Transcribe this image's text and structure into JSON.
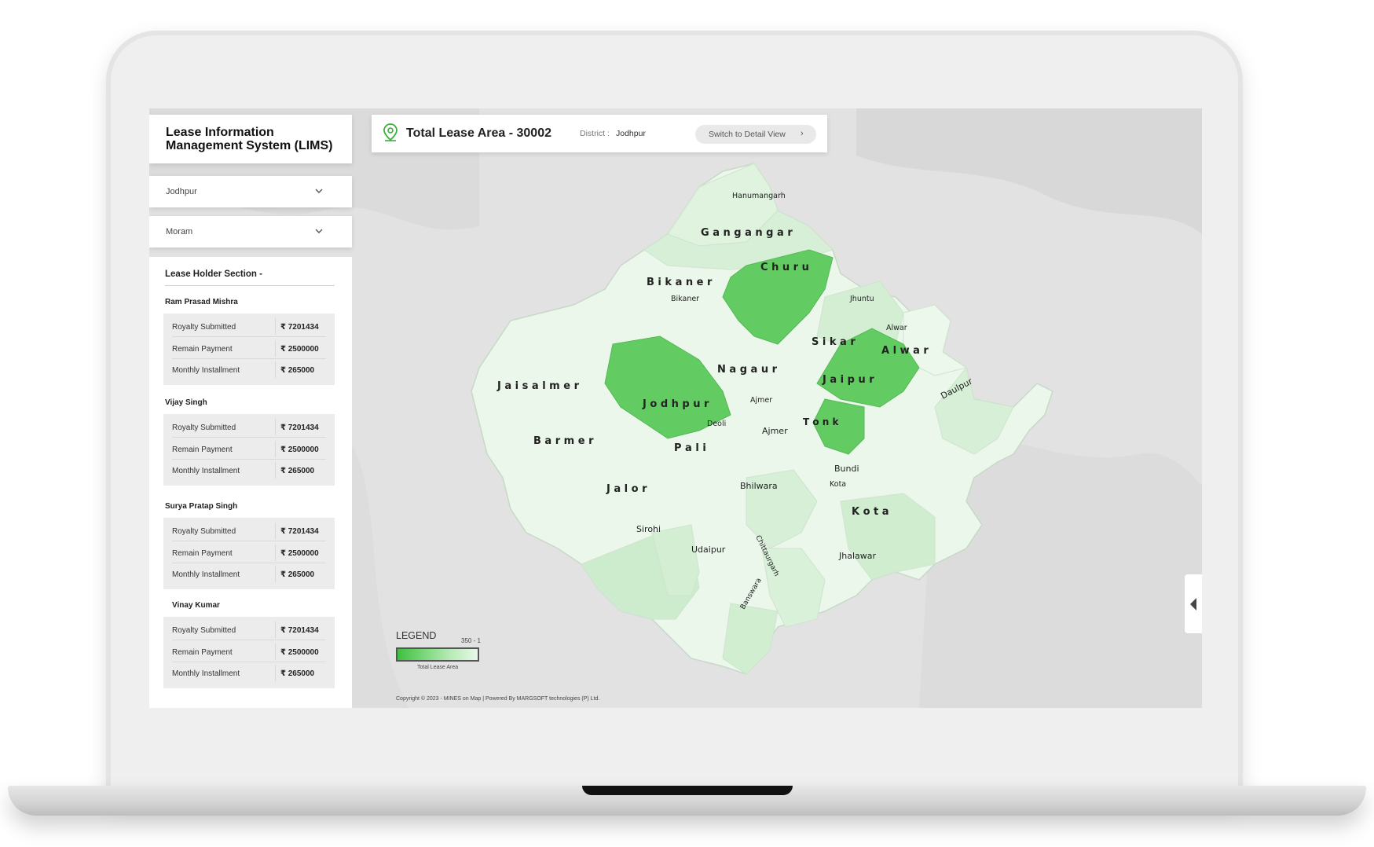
{
  "app": {
    "title_line1": "Lease Information",
    "title_line2": "Management System (LIMS)"
  },
  "filters": {
    "district_value": "Jodhpur",
    "mineral_value": "Moram"
  },
  "lease_holder_section": {
    "title": "Lease Holder Section -",
    "holders": [
      {
        "name": "Ram Prasad Mishra",
        "rows": [
          {
            "label": "Royalty Submitted",
            "value": "₹ 7201434"
          },
          {
            "label": "Remain Payment",
            "value": "₹ 2500000"
          },
          {
            "label": "Monthly Installment",
            "value": "₹ 265000"
          }
        ]
      },
      {
        "name": "Vijay Singh",
        "rows": [
          {
            "label": "Royalty Submitted",
            "value": "₹ 7201434"
          },
          {
            "label": "Remain Payment",
            "value": "₹ 2500000"
          },
          {
            "label": "Monthly Installment",
            "value": "₹ 265000"
          }
        ]
      },
      {
        "name": "Surya Pratap Singh",
        "rows": [
          {
            "label": "Royalty Submitted",
            "value": "₹ 7201434"
          },
          {
            "label": "Remain Payment",
            "value": "₹ 2500000"
          },
          {
            "label": "Monthly Installment",
            "value": "₹ 265000"
          }
        ]
      },
      {
        "name": "Vinay Kumar",
        "rows": [
          {
            "label": "Royalty Submitted",
            "value": "₹ 7201434"
          },
          {
            "label": "Remain Payment",
            "value": "₹ 2500000"
          },
          {
            "label": "Monthly Installment",
            "value": "₹ 265000"
          }
        ]
      }
    ]
  },
  "header": {
    "total_lease_area": "Total Lease Area - 30002",
    "district_label": "District :",
    "district_value": "Jodhpur",
    "switch_button": "Switch to Detail View",
    "switch_chevron": "›"
  },
  "map": {
    "districts": {
      "hanumangarh": "Hanumangarh",
      "ganganagar": "G a n g a n g a r",
      "churu": "C h u r u",
      "bikaner": "B i k a n e r",
      "bikaner_city": "Bikaner",
      "jhunjhunu": "Jhuntu",
      "alwar_city": "Alwar",
      "alwar": "A l w a r",
      "sikar": "S i k a r",
      "jaisalmer": "J a i s a l m e r",
      "nagaur": "N a g a u r",
      "jaipur": "J a i p u r",
      "jodhpur": "J o d h p u r",
      "ajmer_city": "Ajmer",
      "dausa": "Daulpur",
      "beawar": "Deoli",
      "barmer": "B a r m e r",
      "ajmer": "Ajmer",
      "tonk": "T o n k",
      "pali": "P a l i",
      "bundi": "Bundi",
      "kota_city": "Kota",
      "jalor": "J a l o r",
      "bhilwara": "Bhilwara",
      "kota": "K o t a",
      "sirohi": "Sirohi",
      "udaipur": "Udaipur",
      "chittaurgarh": "Chittaurgarh",
      "jhalawar": "Jhalawar",
      "banswara": "Banswara"
    },
    "highlighted_color": "#62cc62",
    "light_color": "#e4f5e4",
    "mid_color": "#cdeccd"
  },
  "legend": {
    "title": "LEGEND",
    "range": "350 - 1",
    "caption": "Total Lease Area"
  },
  "footer": {
    "copyright": "Copyright © 2023 - MINES on Map   |   Powered By MARGSOFT technologies (P) Ltd."
  }
}
